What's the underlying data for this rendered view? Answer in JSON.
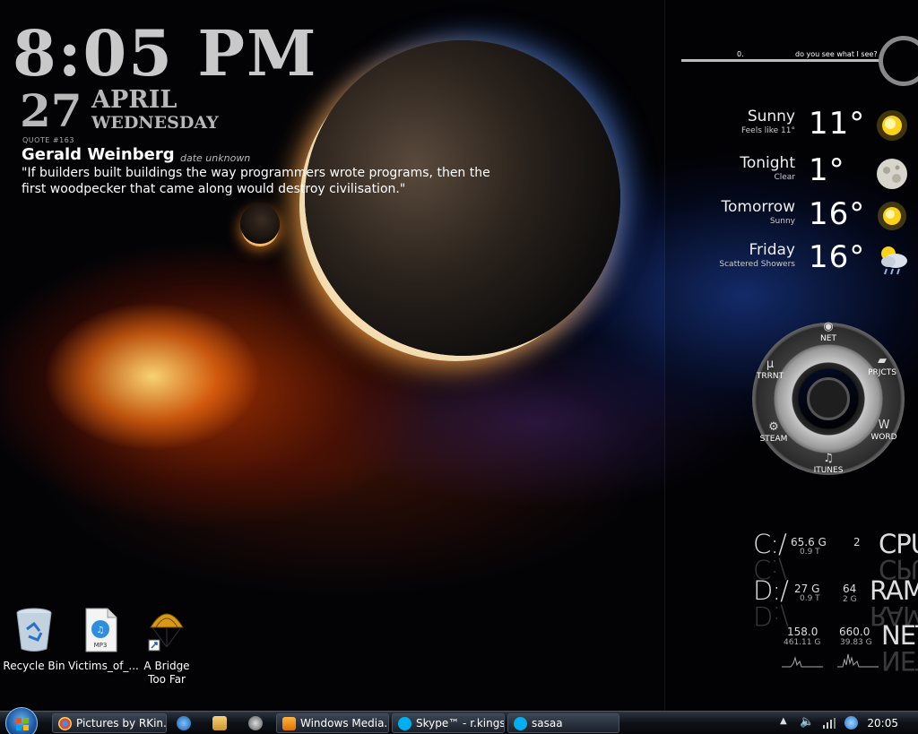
{
  "clock": {
    "time": "8:05 PM",
    "day": "27",
    "month": "APRIL",
    "weekday": "WEDNESDAY"
  },
  "quote": {
    "number": "QUOTE #163",
    "author": "Gerald Weinberg",
    "date": "date unknown",
    "text": "\"If builders built buildings the way programmers wrote programs, then the first woodpecker that came along would destroy civilisation.\""
  },
  "top_bar": {
    "value": "0.",
    "caption": "do you see what I see?"
  },
  "weather": [
    {
      "condition": "Sunny",
      "detail": "Feels like 11°",
      "temp": "11°",
      "icon": "sun-icon"
    },
    {
      "condition": "Tonight",
      "detail": "Clear",
      "temp": "1°",
      "icon": "moon-icon"
    },
    {
      "condition": "Tomorrow",
      "detail": "Sunny",
      "temp": "16°",
      "icon": "sun-icon"
    },
    {
      "condition": "Friday",
      "detail": "Scattered Showers",
      "temp": "16°",
      "icon": "showers-icon"
    }
  ],
  "launcher": {
    "net": "NET",
    "projects": "PRJCTS",
    "torrent": "TRRNT",
    "steam": "STEAM",
    "word": "WORD",
    "itunes": "ITUNES",
    "torrent_glyph": "µ"
  },
  "stats": {
    "c_drive": {
      "label": "C:/",
      "size": "65.6 G",
      "total": "0.9 T",
      "cpu_value": "2",
      "cpu_label": "CPU"
    },
    "d_drive": {
      "label": "D:/",
      "size": "27 G",
      "total": "0.9 T",
      "ram_value": "64",
      "ram_total": "2 G",
      "ram_label": "RAM"
    },
    "net": {
      "down": "158.0",
      "down_total": "461.11 G",
      "up": "660.0",
      "up_total": "39.83 G",
      "label": "NET"
    }
  },
  "desktop_icons": [
    {
      "label": "Recycle Bin",
      "icon": "recycle-bin-icon"
    },
    {
      "label": "Victims_of_...",
      "icon": "mp3-file-icon"
    },
    {
      "label": "A Bridge Too Far",
      "icon": "parachute-shortcut-icon"
    }
  ],
  "taskbar": {
    "buttons": [
      {
        "label": "Pictures by RKin...",
        "icon": "chrome-icon"
      },
      {
        "label": "Windows Media...",
        "icon": "media-player-icon"
      },
      {
        "label": "Skype™ - r.kings...",
        "icon": "skype-icon"
      },
      {
        "label": "sasaa",
        "icon": "skype-icon"
      }
    ],
    "clock": "20:05"
  },
  "colors": {
    "taskbar": "#0e1218",
    "sun": "#ffd21a",
    "orange_glow": "#ff7a14",
    "blue_glow": "#285ad8"
  }
}
